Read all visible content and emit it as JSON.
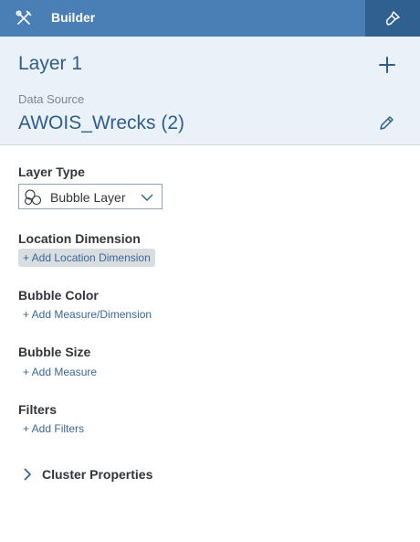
{
  "topbar": {
    "title": "Builder",
    "tools_icon": "tools-icon",
    "brush_icon": "paintbrush-icon"
  },
  "header": {
    "layer_title": "Layer 1",
    "data_source_label": "Data Source",
    "data_source_name": "AWOIS_Wrecks (2)"
  },
  "layer_type": {
    "label": "Layer Type",
    "value": "Bubble Layer"
  },
  "location_dimension": {
    "label": "Location Dimension",
    "add_label": "+ Add Location Dimension"
  },
  "bubble_color": {
    "label": "Bubble Color",
    "add_label": "+ Add Measure/Dimension"
  },
  "bubble_size": {
    "label": "Bubble Size",
    "add_label": "+ Add Measure"
  },
  "filters": {
    "label": "Filters",
    "add_label": "+ Add Filters"
  },
  "cluster": {
    "label": "Cluster Properties"
  },
  "colors": {
    "topbar": "#4a7fb5",
    "topbar_active": "#30608f",
    "header_bg": "#eaf1f8",
    "accent": "#2f5e8c",
    "link": "#3b6797"
  }
}
